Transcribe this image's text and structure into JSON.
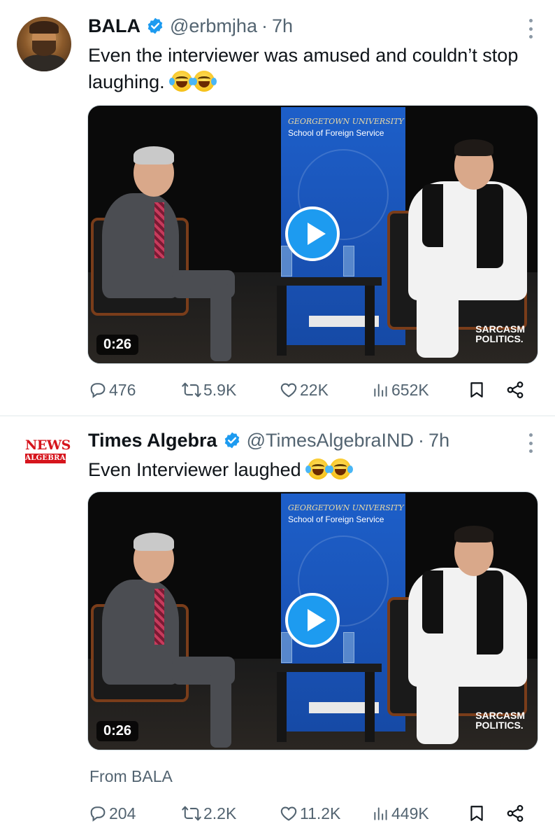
{
  "tweets": [
    {
      "name": "BALA",
      "handle": "@erbmjha",
      "separator": "·",
      "time": "7h",
      "text": "Even the interviewer was amused and couldn’t stop laughing.",
      "emojis": [
        "face-with-tears-of-joy",
        "face-with-tears-of-joy"
      ],
      "video": {
        "duration": "0:26",
        "banner_line1": "GEORGETOWN UNIVERSITY",
        "banner_line2": "School of Foreign Service",
        "watermark_line1": "SARCASM",
        "watermark_line2": "POLITICS."
      },
      "stats": {
        "replies": "476",
        "reposts": "5.9K",
        "likes": "22K",
        "views": "652K"
      }
    },
    {
      "name": "Times Algebra",
      "handle": "@TimesAlgebraIND",
      "separator": "·",
      "time": "7h",
      "text": "Even Interviewer laughed",
      "emojis": [
        "face-with-tears-of-joy",
        "face-with-tears-of-joy"
      ],
      "avatar_logo": {
        "line1": "NEWS",
        "line2": "ALGEBRA"
      },
      "video": {
        "duration": "0:26",
        "banner_line1": "GEORGETOWN UNIVERSITY",
        "banner_line2": "School of Foreign Service",
        "watermark_line1": "SARCASM",
        "watermark_line2": "POLITICS."
      },
      "attribution": "From BALA",
      "stats": {
        "replies": "204",
        "reposts": "2.2K",
        "likes": "11.2K",
        "views": "449K"
      }
    }
  ],
  "colors": {
    "verified": "#1d9bf0",
    "secondary_text": "#536471",
    "play_button": "#1d9bf0",
    "logo_red": "#d6141c"
  }
}
